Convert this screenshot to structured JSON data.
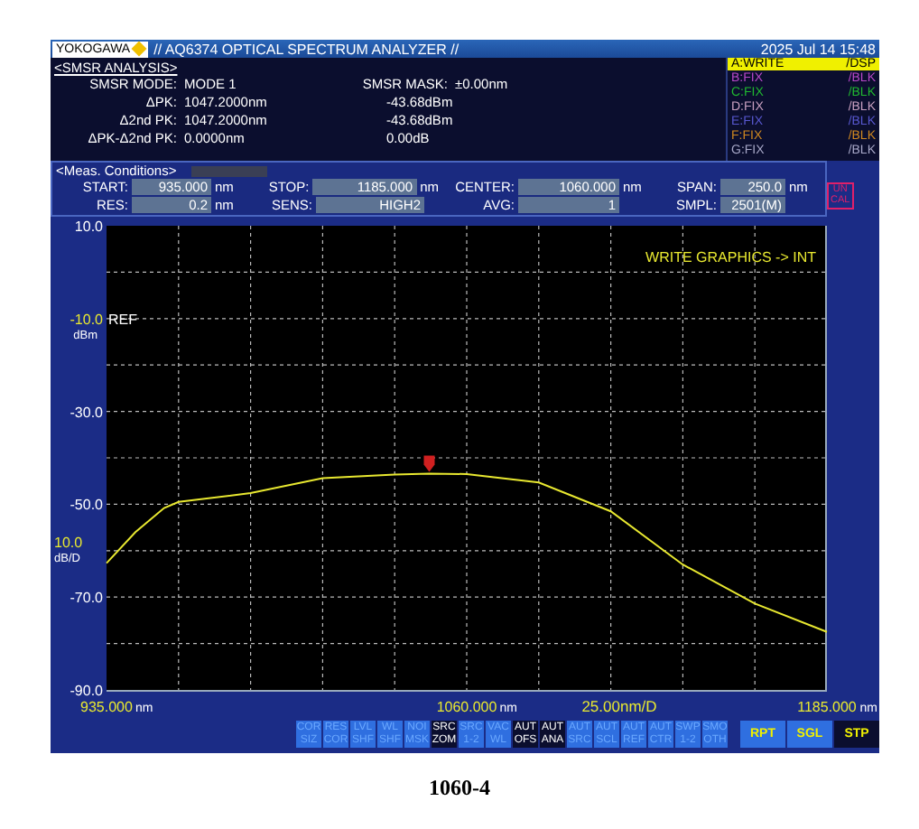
{
  "header": {
    "brand": "YOKOGAWA",
    "title": "// AQ6374 OPTICAL SPECTRUM ANALYZER //",
    "datetime": "2025 Jul 14 15:48"
  },
  "analysis": {
    "heading": "<SMSR ANALYSIS>",
    "rows": [
      {
        "label": "SMSR MODE:",
        "value": "MODE 1",
        "label2": "SMSR MASK:",
        "value2": "±0.00nm"
      },
      {
        "label": "ΔPK:",
        "value": "1047.2000nm",
        "value2": "-43.68dBm"
      },
      {
        "label": "Δ2nd PK:",
        "value": "1047.2000nm",
        "value2": "-43.68dBm"
      },
      {
        "label": "ΔPK-Δ2nd PK:",
        "value": "0.0000nm",
        "value2": "0.00dB"
      }
    ]
  },
  "traces": [
    {
      "name": "A:WRITE",
      "mode": "/DSP",
      "color": "#f0f000",
      "selected": true
    },
    {
      "name": "B:FIX",
      "mode": "/BLK",
      "color": "#b848c8",
      "selected": false
    },
    {
      "name": "C:FIX",
      "mode": "/BLK",
      "color": "#20b830",
      "selected": false
    },
    {
      "name": "D:FIX",
      "mode": "/BLK",
      "color": "#c8a0c0",
      "selected": false
    },
    {
      "name": "E:FIX",
      "mode": "/BLK",
      "color": "#5858d0",
      "selected": false
    },
    {
      "name": "F:FIX",
      "mode": "/BLK",
      "color": "#d08820",
      "selected": false
    },
    {
      "name": "G:FIX",
      "mode": "/BLK",
      "color": "#a8a8c8",
      "selected": false
    }
  ],
  "conditions": {
    "heading": "<Meas. Conditions>",
    "fields": [
      {
        "label": "START:",
        "value": "935.000",
        "unit": "nm"
      },
      {
        "label": "STOP:",
        "value": "1185.000",
        "unit": "nm"
      },
      {
        "label": "CENTER:",
        "value": "1060.000",
        "unit": "nm"
      },
      {
        "label": "SPAN:",
        "value": "250.0",
        "unit": "nm"
      },
      {
        "label": "RES:",
        "value": "0.2",
        "unit": "nm"
      },
      {
        "label": "SENS:",
        "value": "HIGH2"
      },
      {
        "label": "AVG:",
        "value": "1"
      },
      {
        "label": "SMPL:",
        "value": "2501(M)"
      }
    ],
    "uncal": [
      "UN",
      "CAL"
    ]
  },
  "plot": {
    "message": "WRITE GRAPHICS -> INT",
    "x_tick_units": [
      "nm",
      "nm",
      "nm"
    ],
    "ref_level": "-10.0",
    "ref_label": "REF",
    "ref_unit": "dBm",
    "scale": "10.0",
    "scale_unit": "dB/D",
    "span_per_div": "25.00nm/D",
    "chart_data": {
      "type": "line",
      "grid": true,
      "xlim": [
        935,
        1185
      ],
      "ylim": [
        -90,
        10
      ],
      "x": [
        935,
        945,
        955,
        960,
        985,
        1010,
        1035,
        1047,
        1060,
        1085,
        1110,
        1135,
        1160,
        1185
      ],
      "values": [
        -62.7,
        -56,
        -50.8,
        -49.5,
        -47.6,
        -44.4,
        -43.6,
        -43.4,
        -43.5,
        -45.3,
        -51.5,
        -63,
        -71.4,
        -77.5
      ],
      "yticks": [
        {
          "value": 10,
          "label": "10.0"
        },
        {
          "value": -30,
          "label": "-30.0"
        },
        {
          "value": -50,
          "label": "-50.0"
        },
        {
          "value": -70,
          "label": "-70.0"
        },
        {
          "value": -90,
          "label": "-90.0"
        }
      ],
      "xticks": [
        {
          "value": 935,
          "label": "935.000"
        },
        {
          "value": 1060,
          "label": "1060.000"
        },
        {
          "value": 1185,
          "label": "1185.000"
        }
      ]
    }
  },
  "softkeys": [
    {
      "top": "COR",
      "bottom": "SIZ",
      "selected": false
    },
    {
      "top": "RES",
      "bottom": "COR",
      "selected": false
    },
    {
      "top": "LVL",
      "bottom": "SHF",
      "selected": false
    },
    {
      "top": "WL",
      "bottom": "SHF",
      "selected": false
    },
    {
      "top": "NOI",
      "bottom": "MSK",
      "selected": false
    },
    {
      "top": "SRC",
      "bottom": "ZOM",
      "selected": true
    },
    {
      "top": "SRC",
      "bottom": "1-2",
      "selected": false
    },
    {
      "top": "VAC",
      "bottom": "WL",
      "selected": false
    },
    {
      "top": "AUT",
      "bottom": "OFS",
      "selected": true
    },
    {
      "top": "AUT",
      "bottom": "ANA",
      "selected": true
    },
    {
      "top": "AUT",
      "bottom": "SRC",
      "selected": false
    },
    {
      "top": "AUT",
      "bottom": "SCL",
      "selected": false
    },
    {
      "top": "AUT",
      "bottom": "REF",
      "selected": false
    },
    {
      "top": "AUT",
      "bottom": "CTR",
      "selected": false
    },
    {
      "top": "SWP",
      "bottom": "1-2",
      "selected": false
    },
    {
      "top": "SMO",
      "bottom": "OTH",
      "selected": false
    }
  ],
  "run_keys": [
    {
      "label": "RPT",
      "selected": false
    },
    {
      "label": "SGL",
      "selected": false
    },
    {
      "label": "STP",
      "selected": true
    }
  ],
  "caption": "1060-4"
}
